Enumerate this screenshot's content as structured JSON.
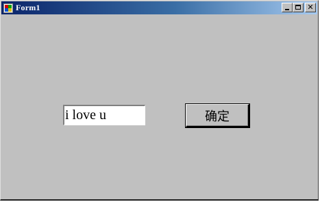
{
  "window": {
    "title": "Form1"
  },
  "form": {
    "text_input_value": "i love u",
    "confirm_label": "确定"
  },
  "colors": {
    "form_background": "#c0c0c0",
    "titlebar_start": "#0a246a",
    "titlebar_end": "#a6caf0"
  }
}
